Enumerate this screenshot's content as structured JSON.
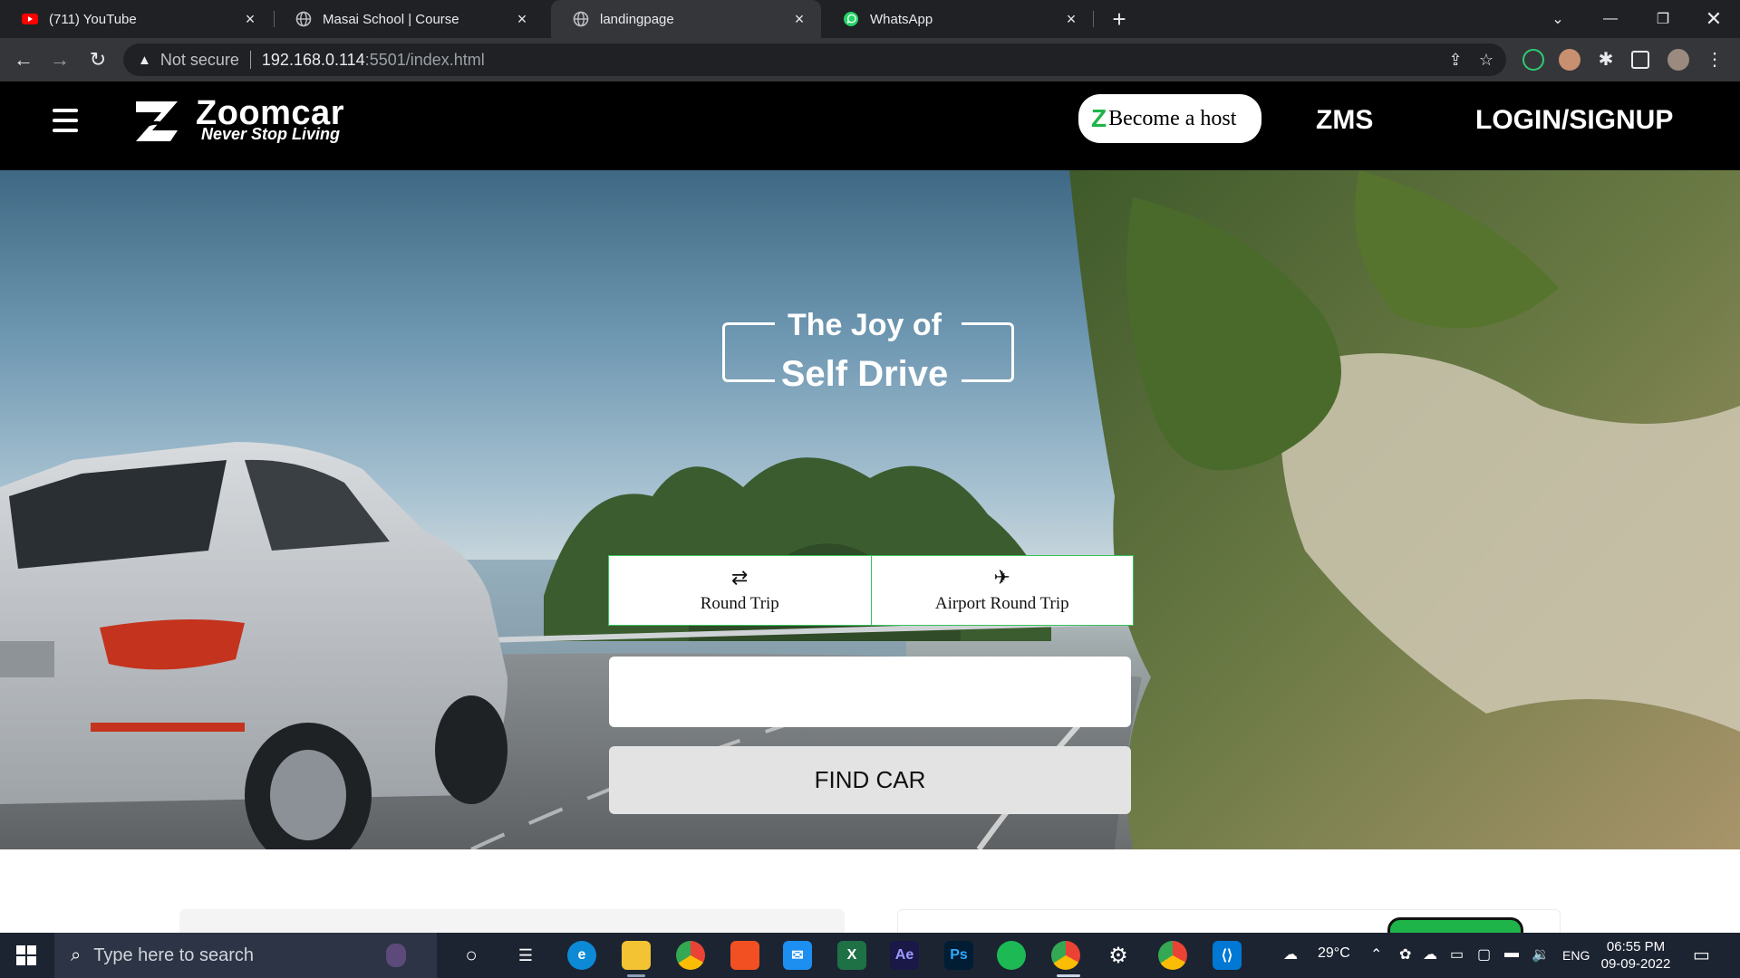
{
  "browser": {
    "tabs": [
      {
        "title": "(711) YouTube",
        "icon": "youtube-icon"
      },
      {
        "title": "Masai School | Course",
        "icon": "globe-icon"
      },
      {
        "title": "landingpage",
        "icon": "globe-icon",
        "active": true
      },
      {
        "title": "WhatsApp",
        "icon": "whatsapp-icon"
      }
    ],
    "address": {
      "security_text": "Not secure",
      "url_host": "192.168.0.114",
      "url_rest": ":5501/index.html"
    }
  },
  "site": {
    "brand_name": "Zoomcar",
    "brand_tagline": "Never Stop Living",
    "host_button": "Become a host",
    "nav": {
      "zms": "ZMS",
      "login": "LOGIN/SIGNUP"
    }
  },
  "hero": {
    "line1": "The Joy of",
    "line2": "Self Drive",
    "trip_tabs": [
      {
        "label": "Round Trip",
        "icon": "⇄"
      },
      {
        "label": "Airport Round Trip",
        "icon": "✈"
      }
    ],
    "location_value": "",
    "find_button": "FIND CAR"
  },
  "taskbar": {
    "search_placeholder": "Type here to search",
    "weather": "29°C",
    "language": "ENG",
    "time": "06:55 PM",
    "date": "09-09-2022"
  },
  "colors": {
    "brand_green": "#1fb449",
    "header_bg": "#000000",
    "chrome_bg": "#202124",
    "taskbar_bg": "#1c2432"
  }
}
